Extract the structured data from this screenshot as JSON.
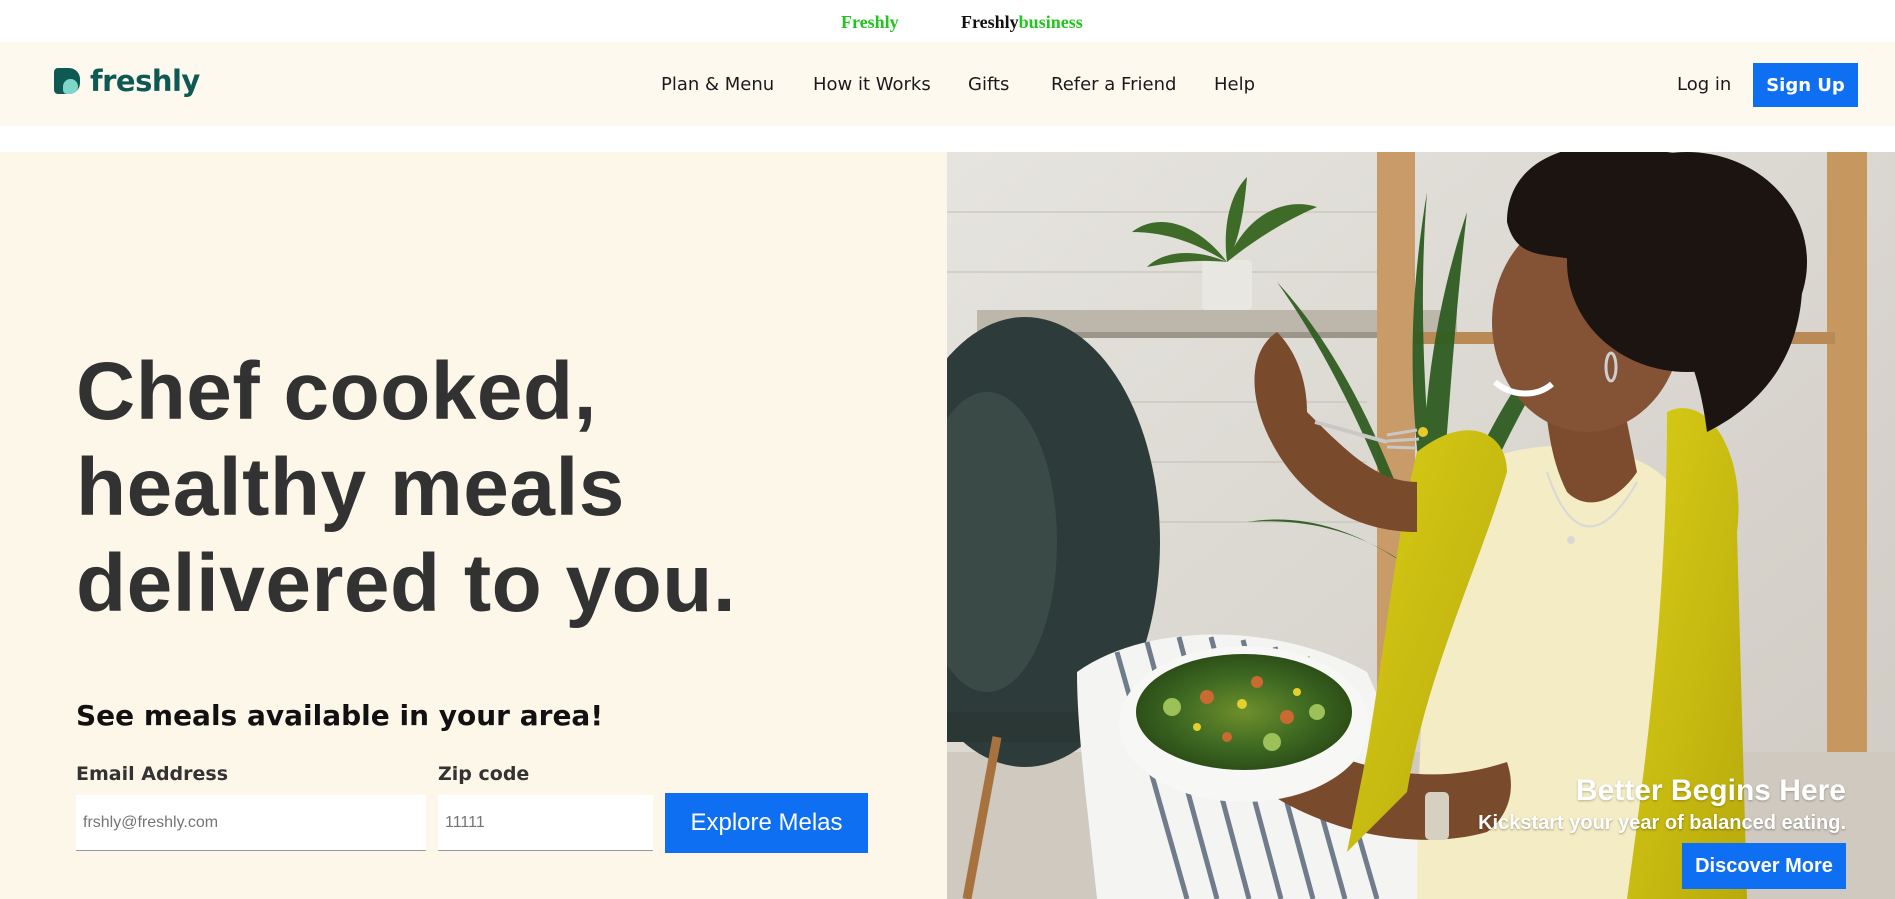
{
  "top_strip": {
    "freshly_link": "Freshly",
    "business_link_part1": "Freshly",
    "business_link_part2": "business"
  },
  "header": {
    "logo_text": "freshly",
    "nav": {
      "plan_menu": "Plan & Menu",
      "how_it_works": "How it Works",
      "gifts": "Gifts",
      "refer_friend": "Refer a Friend",
      "help": "Help"
    },
    "login": "Log in",
    "signup": "Sign Up"
  },
  "hero": {
    "headline": "Chef cooked, healthy meals delivered to you.",
    "subhead": "See meals available in your area!",
    "email_label": "Email Address",
    "email_placeholder": "frshly@freshly.com",
    "zip_label": "Zip code",
    "zip_placeholder": "11111",
    "explore_button": "Explore Melas"
  },
  "image_overlay": {
    "title": "Better Begins Here",
    "subtitle": "Kickstart your year of balanced eating.",
    "button": "Discover More"
  },
  "colors": {
    "accent_blue": "#0f6ff2",
    "brand_green": "#22c51f",
    "logo_teal": "#0e5a53",
    "hero_cream": "#fdf7ea",
    "header_cream": "#fdf9ef",
    "headline_gray": "#323232"
  },
  "icons": {
    "logo_mark": "freshly-logo-mark"
  }
}
